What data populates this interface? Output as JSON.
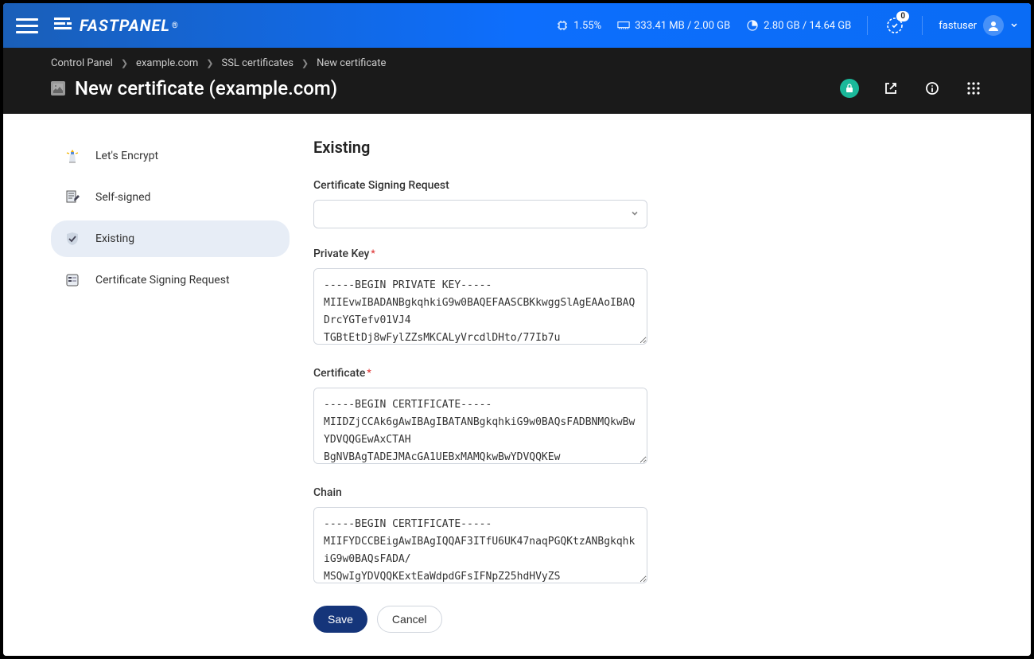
{
  "header": {
    "brand": "FASTPANEL",
    "cpu": "1.55%",
    "ram": "333.41 MB / 2.00 GB",
    "disk": "2.80 GB / 14.64 GB",
    "notif_count": "0",
    "username": "fastuser"
  },
  "breadcrumb": {
    "items": [
      "Control Panel",
      "example.com",
      "SSL certificates",
      "New certificate"
    ]
  },
  "page": {
    "title": "New certificate (example.com)"
  },
  "sidenav": {
    "items": [
      {
        "label": "Let's Encrypt"
      },
      {
        "label": "Self-signed"
      },
      {
        "label": "Existing"
      },
      {
        "label": "Certificate Signing Request"
      }
    ]
  },
  "form": {
    "heading": "Existing",
    "csr_label": "Certificate Signing Request",
    "csr_value": "",
    "private_key_label": "Private Key",
    "private_key_value": "-----BEGIN PRIVATE KEY-----\nMIIEvwIBADANBgkqhkiG9w0BAQEFAASCBKkwggSlAgEAAoIBAQDrcYGTefv01VJ4\nTGBtEtDj8wFylZZsMKCALyVrcdlDHto/77Ib7u",
    "certificate_label": "Certificate",
    "certificate_value": "-----BEGIN CERTIFICATE-----\nMIIDZjCCAk6gAwIBAgIBATANBgkqhkiG9w0BAQsFADBNMQkwBwYDVQQGEwAxCTAH\nBgNVBAgTADEJMAcGA1UEBxMAMQkwBwYDVQQKEw",
    "chain_label": "Chain",
    "chain_value": "-----BEGIN CERTIFICATE-----\nMIIFYDCCBEigAwIBAgIQQAF3ITfU6UK47naqPGQKtzANBgkqhkiG9w0BAQsFADA/\nMSQwIgYDVQQKExtEaWdpdGFsIFNpZ25hdHVyZS",
    "save_label": "Save",
    "cancel_label": "Cancel"
  }
}
